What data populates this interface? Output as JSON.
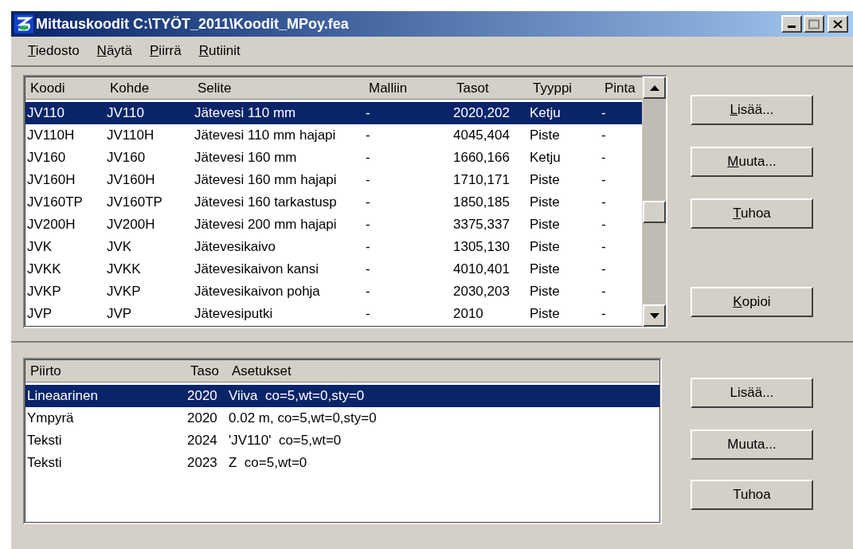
{
  "window": {
    "title": "Mittauskoodit C:\\TYÖT_2011\\Koodit_MPoy.fea"
  },
  "menu": [
    {
      "label": "Tiedosto",
      "mnemonic": true
    },
    {
      "label": "Näytä",
      "mnemonic": true
    },
    {
      "label": "Piirrä",
      "mnemonic": true
    },
    {
      "label": "Rutiinit",
      "mnemonic": true
    }
  ],
  "codes_table": {
    "columns": [
      "Koodi",
      "Kohde",
      "Selite",
      "Malliin",
      "Tasot",
      "Tyyppi",
      "Pinta"
    ],
    "rows": [
      {
        "cells": [
          "JV110",
          "JV110",
          "Jätevesi 110 mm",
          "-",
          "2020,202",
          "Ketju",
          "-"
        ],
        "selected": true
      },
      {
        "cells": [
          "JV110H",
          "JV110H",
          "Jätevesi 110 mm hajapi",
          "-",
          "4045,404",
          "Piste",
          "-"
        ],
        "selected": false
      },
      {
        "cells": [
          "JV160",
          "JV160",
          "Jätevesi 160 mm",
          "-",
          "1660,166",
          "Ketju",
          "-"
        ],
        "selected": false
      },
      {
        "cells": [
          "JV160H",
          "JV160H",
          "Jätevesi 160 mm hajapi",
          "-",
          "1710,171",
          "Piste",
          "-"
        ],
        "selected": false
      },
      {
        "cells": [
          "JV160TP",
          "JV160TP",
          "Jätevesi 160 tarkastusp",
          "-",
          "1850,185",
          "Piste",
          "-"
        ],
        "selected": false
      },
      {
        "cells": [
          "JV200H",
          "JV200H",
          "Jätevesi 200 mm hajapi",
          "-",
          "3375,337",
          "Piste",
          "-"
        ],
        "selected": false
      },
      {
        "cells": [
          "JVK",
          "JVK",
          "Jätevesikaivo",
          "-",
          "1305,130",
          "Piste",
          "-"
        ],
        "selected": false
      },
      {
        "cells": [
          "JVKK",
          "JVKK",
          "Jätevesikaivon kansi",
          "-",
          "4010,401",
          "Piste",
          "-"
        ],
        "selected": false
      },
      {
        "cells": [
          "JVKP",
          "JVKP",
          "Jätevesikaivon pohja",
          "-",
          "2030,203",
          "Piste",
          "-"
        ],
        "selected": false
      },
      {
        "cells": [
          "JVP",
          "JVP",
          "Jätevesiputki",
          "-",
          "2010",
          "Piste",
          "-"
        ],
        "selected": false
      }
    ]
  },
  "code_buttons": [
    {
      "label": "Lisää...",
      "mnemonic": true
    },
    {
      "label": "Muuta...",
      "mnemonic": true
    },
    {
      "label": "Tuhoa",
      "mnemonic": true
    },
    {
      "label": "Kopioi",
      "mnemonic": true
    }
  ],
  "drawing_table": {
    "columns": [
      "Piirto",
      "Taso",
      "Asetukset"
    ],
    "rows": [
      {
        "cells": [
          "Lineaarinen",
          "2020",
          "Viiva  co=5,wt=0,sty=0"
        ],
        "selected": true
      },
      {
        "cells": [
          "Ympyrä",
          "2020",
          "0.02 m, co=5,wt=0,sty=0"
        ],
        "selected": false
      },
      {
        "cells": [
          "Teksti",
          "2024",
          "'JV110'  co=5,wt=0"
        ],
        "selected": false
      },
      {
        "cells": [
          "Teksti",
          "2023",
          "Z  co=5,wt=0"
        ],
        "selected": false
      }
    ]
  },
  "drawing_buttons": [
    {
      "label": "Lisää...",
      "mnemonic": false
    },
    {
      "label": "Muuta...",
      "mnemonic": false
    },
    {
      "label": "Tuhoa",
      "mnemonic": false
    }
  ]
}
